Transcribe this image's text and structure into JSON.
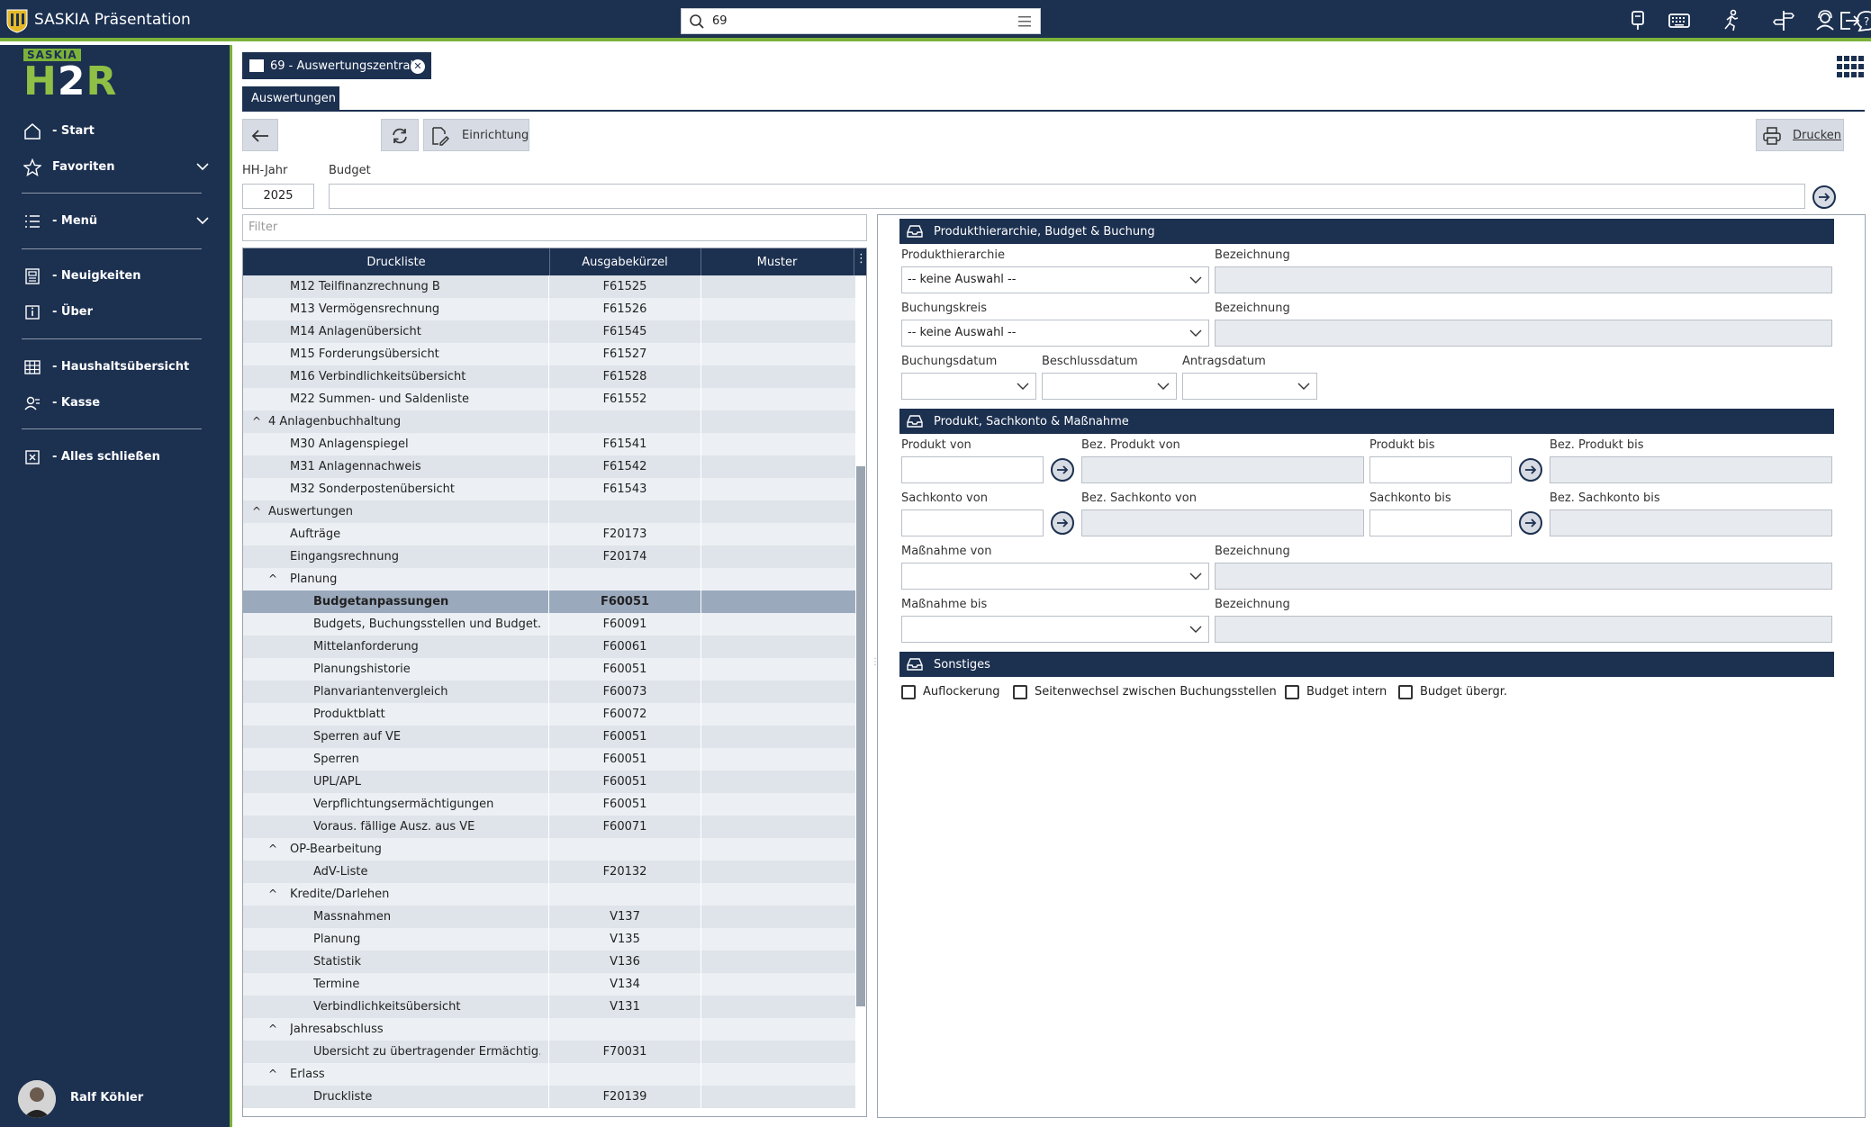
{
  "topbar": {
    "app_title": "SASKIA Präsentation",
    "search_value": "69",
    "icons": [
      "dashboard-icon",
      "keyboard-icon",
      "user-run-icon",
      "signpost-icon",
      "user-headset-icon",
      "help-icon",
      "logout-icon"
    ]
  },
  "sidebar": {
    "brand_top": "SASKIA",
    "brand_main": "H2R",
    "items": [
      {
        "label": "- Start",
        "icon": "home-icon"
      },
      {
        "label": "Favoriten",
        "icon": "star-icon"
      },
      {
        "label": "- Menü",
        "icon": "list-icon"
      },
      {
        "label": "- Neuigkeiten",
        "icon": "news-icon"
      },
      {
        "label": "- Über",
        "icon": "info-icon"
      },
      {
        "label": "- Haushaltsübersicht",
        "icon": "table-icon"
      },
      {
        "label": "- Kasse",
        "icon": "users-icon"
      },
      {
        "label": "- Alles schließen",
        "icon": "close-box-icon"
      }
    ],
    "user_name": "Ralf Köhler"
  },
  "tabs": {
    "main_tab": "69 - Auswertungszentrale",
    "sub_tab": "Auswertungen"
  },
  "toolbar": {
    "setup_label": "Einrichtung",
    "print_label": "Drucken"
  },
  "form": {
    "hh_jahr_label": "HH-Jahr",
    "hh_jahr_value": "2025",
    "budget_label": "Budget",
    "budget_value": ""
  },
  "list": {
    "filter_placeholder": "Filter",
    "columns": [
      "Druckliste",
      "Ausgabekürzel",
      "Muster"
    ],
    "rows": [
      {
        "label": "M12   Teilfinanzrechnung B",
        "code": "F61525",
        "indent": 2
      },
      {
        "label": "M13   Vermögensrechnung",
        "code": "F61526",
        "indent": 2
      },
      {
        "label": "M14 Anlagenübersicht",
        "code": "F61545",
        "indent": 2
      },
      {
        "label": "M15   Forderungsübersicht",
        "code": "F61527",
        "indent": 2
      },
      {
        "label": "M16   Verbindlichkeitsübersicht",
        "code": "F61528",
        "indent": 2
      },
      {
        "label": "M22 Summen- und Saldenliste",
        "code": "F61552",
        "indent": 2
      },
      {
        "label": "4 Anlagenbuchhaltung",
        "code": "",
        "indent": 1,
        "group": true
      },
      {
        "label": "M30 Anlagenspiegel",
        "code": "F61541",
        "indent": 2
      },
      {
        "label": "M31 Anlagennachweis",
        "code": "F61542",
        "indent": 2
      },
      {
        "label": "M32 Sonderpostenübersicht",
        "code": "F61543",
        "indent": 2
      },
      {
        "label": "Auswertungen",
        "code": "",
        "indent": 1,
        "group": true
      },
      {
        "label": "Aufträge",
        "code": "F20173",
        "indent": 2
      },
      {
        "label": "Eingangsrechnung",
        "code": "F20174",
        "indent": 2
      },
      {
        "label": "Planung",
        "code": "",
        "indent": 2,
        "group": true
      },
      {
        "label": "Budgetanpassungen",
        "code": "F60051",
        "indent": 3,
        "selected": true
      },
      {
        "label": "Budgets, Buchungsstellen und Budget...",
        "code": "F60091",
        "indent": 3
      },
      {
        "label": "Mittelanforderung",
        "code": "F60061",
        "indent": 3
      },
      {
        "label": "Planungshistorie",
        "code": "F60051",
        "indent": 3
      },
      {
        "label": "Planvariantenvergleich",
        "code": "F60073",
        "indent": 3
      },
      {
        "label": "Produktblatt",
        "code": "F60072",
        "indent": 3
      },
      {
        "label": "Sperren auf VE",
        "code": "F60051",
        "indent": 3
      },
      {
        "label": "Sperren",
        "code": "F60051",
        "indent": 3
      },
      {
        "label": "ÜPL/APL",
        "code": "F60051",
        "indent": 3
      },
      {
        "label": "Verpflichtungsermächtigungen",
        "code": "F60051",
        "indent": 3
      },
      {
        "label": "Voraus. fällige Ausz. aus VE",
        "code": "F60071",
        "indent": 3
      },
      {
        "label": "OP-Bearbeitung",
        "code": "",
        "indent": 2,
        "group": true
      },
      {
        "label": "AdV-Liste",
        "code": "F20132",
        "indent": 3
      },
      {
        "label": "Kredite/Darlehen",
        "code": "",
        "indent": 2,
        "group": true
      },
      {
        "label": "Massnahmen",
        "code": "V137",
        "indent": 3
      },
      {
        "label": "Planung",
        "code": "V135",
        "indent": 3
      },
      {
        "label": "Statistik",
        "code": "V136",
        "indent": 3
      },
      {
        "label": "Termine",
        "code": "V134",
        "indent": 3
      },
      {
        "label": "Verbindlichkeitsübersicht",
        "code": "V131",
        "indent": 3
      },
      {
        "label": "Jahresabschluss",
        "code": "",
        "indent": 2,
        "group": true
      },
      {
        "label": "Übersicht zu übertragender Ermächtig...",
        "code": "F70031",
        "indent": 3
      },
      {
        "label": "Erlass",
        "code": "",
        "indent": 2,
        "group": true
      },
      {
        "label": "Druckliste",
        "code": "F20139",
        "indent": 3
      }
    ]
  },
  "right": {
    "section1": {
      "title": "Produkthierarchie, Budget & Buchung",
      "produkthierarchie_label": "Produkthierarchie",
      "produkthierarchie_value": "-- keine Auswahl --",
      "bezeichnung_label": "Bezeichnung",
      "buchungskreis_label": "Buchungskreis",
      "buchungskreis_value": "-- keine Auswahl --",
      "buchungsdatum_label": "Buchungsdatum",
      "beschlussdatum_label": "Beschlussdatum",
      "antragsdatum_label": "Antragsdatum"
    },
    "section2": {
      "title": "Produkt, Sachkonto & Maßnahme",
      "produkt_von": "Produkt von",
      "bez_produkt_von": "Bez. Produkt von",
      "produkt_bis": "Produkt bis",
      "bez_produkt_bis": "Bez. Produkt bis",
      "sachkonto_von": "Sachkonto von",
      "bez_sachkonto_von": "Bez. Sachkonto von",
      "sachkonto_bis": "Sachkonto bis",
      "bez_sachkonto_bis": "Bez. Sachkonto bis",
      "massnahme_von": "Maßnahme von",
      "massnahme_bis": "Maßnahme bis",
      "bezeichnung": "Bezeichnung"
    },
    "section3": {
      "title": "Sonstiges",
      "checkboxes": [
        "Auflockerung",
        "Seitenwechsel zwischen Buchungsstellen",
        "Budget intern",
        "Budget übergr."
      ]
    }
  }
}
